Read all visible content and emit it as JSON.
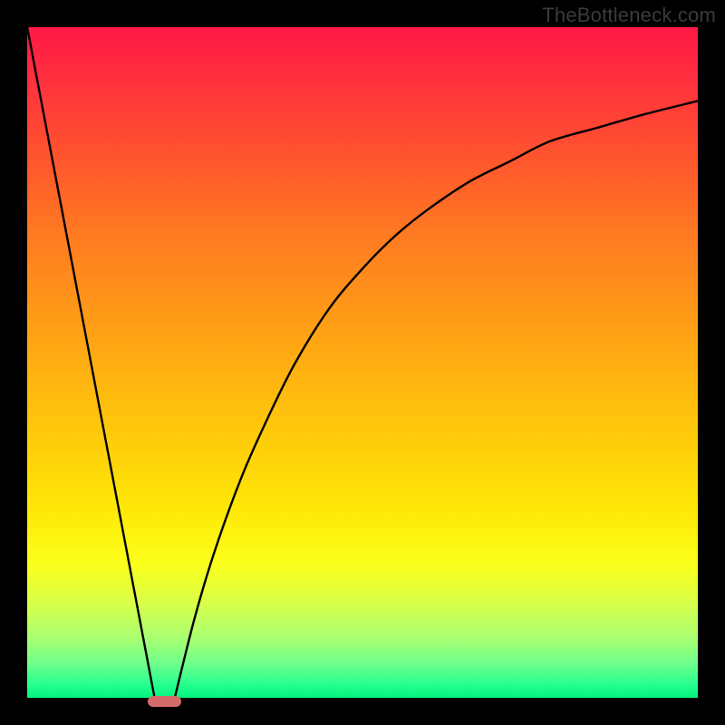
{
  "watermark": "TheBottleneck.com",
  "chart_data": {
    "type": "line",
    "title": "",
    "xlabel": "",
    "ylabel": "",
    "xlim": [
      0,
      100
    ],
    "ylim": [
      0,
      100
    ],
    "grid": false,
    "series": [
      {
        "name": "left-line",
        "x": [
          0,
          19
        ],
        "y": [
          100,
          0
        ]
      },
      {
        "name": "right-curve",
        "x": [
          22,
          25,
          28,
          32,
          36,
          40,
          45,
          50,
          55,
          60,
          66,
          72,
          78,
          85,
          92,
          100
        ],
        "y": [
          0,
          12,
          22,
          33,
          42,
          50,
          58,
          64,
          69,
          73,
          77,
          80,
          83,
          85,
          87,
          89
        ]
      }
    ],
    "marker": {
      "name": "valley-notch",
      "x_start": 18,
      "x_end": 23,
      "y": 0,
      "color": "#d46b6b"
    }
  }
}
